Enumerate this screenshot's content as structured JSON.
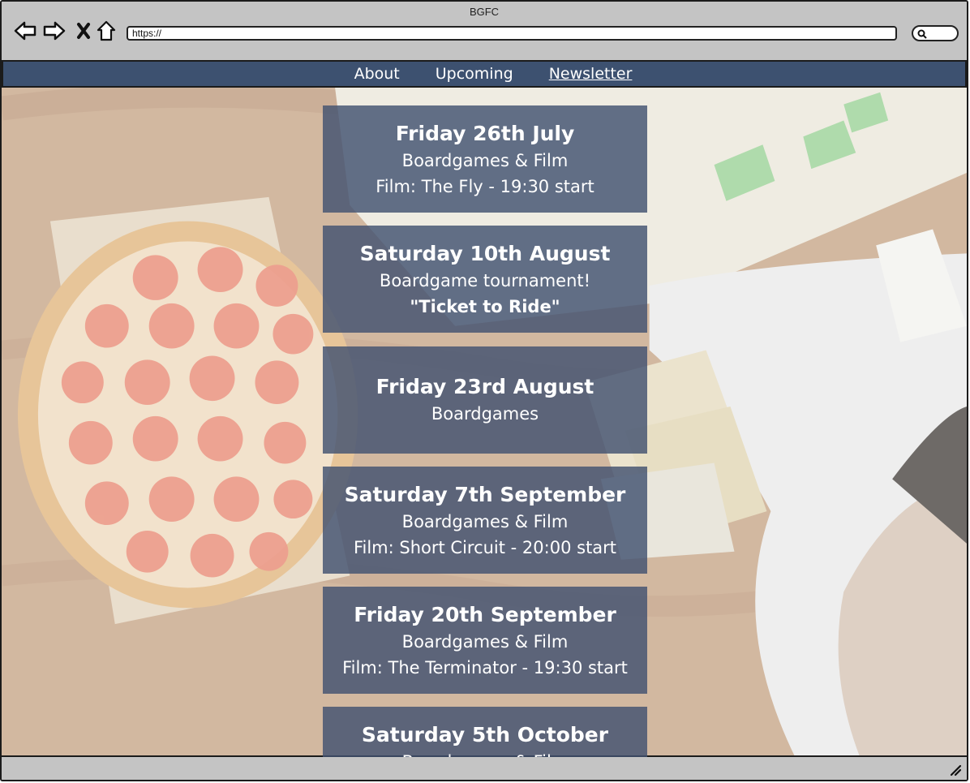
{
  "window": {
    "title": "BGFC"
  },
  "browser": {
    "url": "https://"
  },
  "nav": {
    "items": [
      "About",
      "Upcoming",
      "Newsletter"
    ],
    "active": "Newsletter"
  },
  "events": [
    {
      "date": "Friday 26th July",
      "lines": [
        "Boardgames & Film",
        "Film: The Fly - 19:30 start"
      ]
    },
    {
      "date": "Saturday 10th August",
      "lines": [
        "Boardgame tournament!",
        "\"Ticket to Ride\""
      ]
    },
    {
      "date": "Friday 23rd August",
      "lines": [
        "Boardgames"
      ]
    },
    {
      "date": "Saturday 7th September",
      "lines": [
        "Boardgames & Film",
        "Film: Short Circuit - 20:00 start"
      ]
    },
    {
      "date": "Friday 20th September",
      "lines": [
        "Boardgames & Film",
        "Film: The Terminator - 19:30 start"
      ]
    },
    {
      "date": "Saturday 5th October",
      "lines": [
        "Boardgames & Film"
      ]
    }
  ],
  "colors": {
    "navbar": "#3d5170",
    "card": "#425270",
    "chrome": "#c4c4c4"
  }
}
